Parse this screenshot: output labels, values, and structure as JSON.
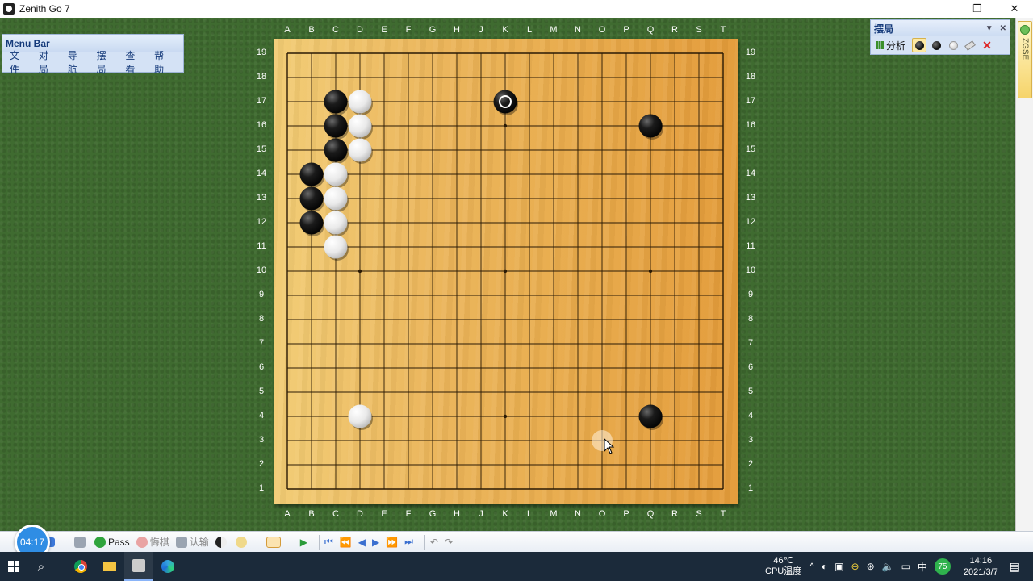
{
  "window": {
    "title": "Zenith Go 7",
    "controls": {
      "minimize": "—",
      "restore": "❐",
      "close": "✕"
    }
  },
  "menu_panel": {
    "title": "Menu Bar",
    "items": [
      "文件",
      "对局",
      "导航",
      "摆局",
      "查看",
      "帮助"
    ]
  },
  "setup_panel": {
    "title": "摆局",
    "analyze_label": "分析",
    "tools": [
      "alternate-stone-icon",
      "black-stone-icon",
      "white-stone-icon",
      "eraser-icon",
      "clear-icon"
    ],
    "selected_tool": "alternate-stone-icon"
  },
  "side_tab": {
    "label": "ZGSE"
  },
  "board": {
    "size": 19,
    "columns": [
      "A",
      "B",
      "C",
      "D",
      "E",
      "F",
      "G",
      "H",
      "J",
      "K",
      "L",
      "M",
      "N",
      "O",
      "P",
      "Q",
      "R",
      "S",
      "T"
    ],
    "rows": [
      "19",
      "18",
      "17",
      "16",
      "15",
      "14",
      "13",
      "12",
      "11",
      "10",
      "9",
      "8",
      "7",
      "6",
      "5",
      "4",
      "3",
      "2",
      "1"
    ],
    "star_points": [
      "D16",
      "K16",
      "Q16",
      "D10",
      "K10",
      "Q10",
      "D4",
      "K4",
      "Q4"
    ],
    "stones": [
      {
        "color": "black",
        "point": "C17"
      },
      {
        "color": "black",
        "point": "C16"
      },
      {
        "color": "black",
        "point": "C15"
      },
      {
        "color": "black",
        "point": "B14"
      },
      {
        "color": "black",
        "point": "B13"
      },
      {
        "color": "black",
        "point": "B12"
      },
      {
        "color": "black",
        "point": "K17",
        "last_move": true
      },
      {
        "color": "black",
        "point": "Q16"
      },
      {
        "color": "black",
        "point": "Q4"
      },
      {
        "color": "white",
        "point": "D17"
      },
      {
        "color": "white",
        "point": "D16"
      },
      {
        "color": "white",
        "point": "D15"
      },
      {
        "color": "white",
        "point": "C14"
      },
      {
        "color": "white",
        "point": "C13"
      },
      {
        "color": "white",
        "point": "C12"
      },
      {
        "color": "white",
        "point": "C11"
      },
      {
        "color": "white",
        "point": "D4"
      }
    ],
    "hover_point": "O3",
    "colors": {
      "black": "#111111",
      "white": "#f2f2f2",
      "line": "#2a1a05"
    }
  },
  "toolbar": {
    "timer": "04:17",
    "pass_label": "Pass",
    "undo_label": "悔棋",
    "resign_label": "认输"
  },
  "taskbar": {
    "cpu_temp": "46℃",
    "cpu_label": "CPU温度",
    "ime": "中",
    "badge": "75",
    "time": "14:16",
    "date": "2021/3/7"
  }
}
